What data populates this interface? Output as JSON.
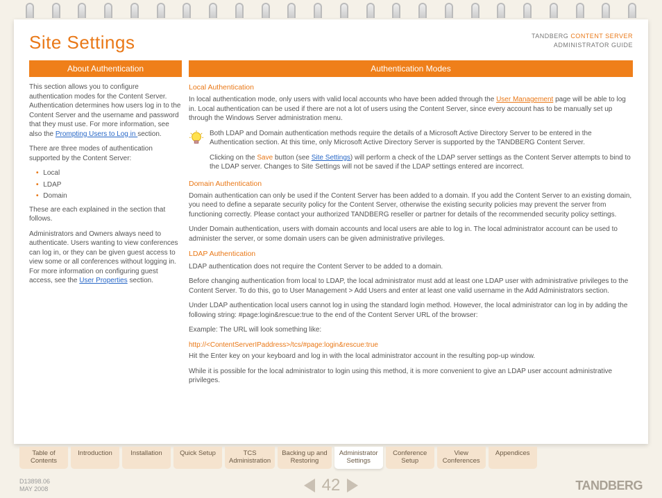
{
  "header": {
    "title": "Site Settings",
    "brand_line1_pre": "TANDBERG ",
    "brand_line1_orange": "CONTENT SERVER",
    "brand_line2": "ADMINISTRATOR GUIDE"
  },
  "left": {
    "heading": "About Authentication",
    "p1_a": "This section allows you to configure authentication modes for the Content Server. Authentication determines how users log in to the Content Server and the username and password that they must use. For more information, see also the ",
    "p1_link": "Prompting Users to Log in ",
    "p1_b": "section.",
    "p2": "There are three modes of authentication supported by the Content Server:",
    "modes": [
      "Local",
      "LDAP",
      "Domain"
    ],
    "p3": "These are each explained in the section that follows.",
    "p4_a": "Administrators and Owners always need to authenticate. Users wanting to view conferences can log in, or they can be given guest access to view some or all conferences without logging in. For more information on configuring guest access, see the ",
    "p4_link": "User Properties",
    "p4_b": " section."
  },
  "right": {
    "heading": "Authentication Modes",
    "local_h": "Local Authentication",
    "local_p_a": "In local authentication mode, only users with valid local accounts who have been added through the ",
    "local_link": "User Management",
    "local_p_b": " page will be able to log in. Local authentication can be used if there are not a lot of users using the Content Server, since every account has to be manually set up through the Windows Server administration menu.",
    "note_p1": "Both LDAP and Domain authentication methods require the details of a Microsoft Active Directory Server to be entered in the Authentication section. At this time, only Microsoft Active Directory Server is supported by the TANDBERG Content Server.",
    "note_p2_a": "Clicking on the ",
    "note_save": "Save",
    "note_p2_b": " button (see ",
    "note_link": "Site Settings",
    "note_p2_c": ") will perform a check of the LDAP server settings as the Content Server attempts to bind to the LDAP server. Changes to Site Settings will not be saved if the LDAP settings entered are incorrect.",
    "domain_h": "Domain Authentication",
    "domain_p1": "Domain authentication can only be used if the Content Server has been added to a domain. If you add the Content Server to an existing domain, you need to define a separate security policy for the Content Server, otherwise the existing security policies may prevent the server from functioning correctly. Please contact your authorized TANDBERG reseller or partner for details of the recommended security policy settings.",
    "domain_p2": "Under Domain authentication, users with domain accounts and local users are able to log in. The local administrator account can be used to administer the server, or some domain users can be given administrative privileges.",
    "ldap_h": "LDAP Authentication",
    "ldap_p1": "LDAP authentication does not require the Content Server to be added to a domain.",
    "ldap_p2": "Before changing authentication from local to LDAP, the local administrator must add at least one LDAP user with administrative privileges to the Content Server. To do this, go to User Management > Add Users and enter at least one valid username in the Add Administrators section.",
    "ldap_p3": "Under LDAP authentication local users cannot log in using the standard login method. However, the local administrator can log in by adding the following string: #page:login&rescue:true to the end of the Content Server URL of the browser:",
    "ldap_p4": "Example: The URL will look something like:",
    "ldap_url": "http://<ContentServerIPaddress>/tcs/#page:login&rescue:true",
    "ldap_p5": "Hit the Enter key on your keyboard and log in with the local administrator account in the resulting pop-up window.",
    "ldap_p6": "While it is possible for the local administrator to login using this method, it is more convenient to give an LDAP user account administrative privileges."
  },
  "tabs": [
    {
      "label": "Table of\nContents",
      "active": false
    },
    {
      "label": "Introduction",
      "active": false
    },
    {
      "label": "Installation",
      "active": false
    },
    {
      "label": "Quick Setup",
      "active": false
    },
    {
      "label": "TCS\nAdministration",
      "active": false
    },
    {
      "label": "Backing up and\nRestoring",
      "active": false
    },
    {
      "label": "Administrator\nSettings",
      "active": true
    },
    {
      "label": "Conference\nSetup",
      "active": false
    },
    {
      "label": "View\nConferences",
      "active": false
    },
    {
      "label": "Appendices",
      "active": false
    }
  ],
  "footer": {
    "doc_code": "D13898.06",
    "doc_date": "MAY 2008",
    "page_number": "42",
    "brand": "TANDBERG"
  }
}
